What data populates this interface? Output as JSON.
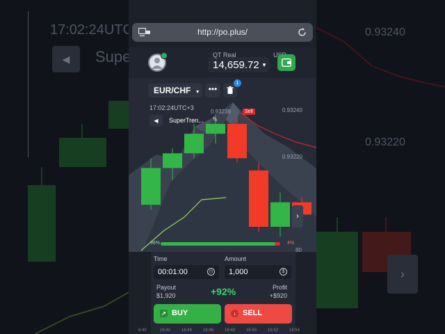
{
  "browser": {
    "url": "http://po.plus/"
  },
  "account": {
    "type": "QT Real",
    "currency": "USD",
    "balance": "14,659.72"
  },
  "chart": {
    "pair": "EUR/CHF",
    "menu_dots": "•••",
    "trash_count": "1",
    "clock": "17:02:24UTC+3",
    "indicator": "SuperTren...",
    "sell_tag": "Sell",
    "prices": [
      "0.93240",
      "0.93238",
      "0.93220"
    ],
    "partial_label": "80",
    "candles": [
      {
        "open": 0.93205,
        "close": 0.9322,
        "high": 0.93224,
        "low": 0.93203,
        "dir": "up"
      },
      {
        "open": 0.9322,
        "close": 0.93226,
        "high": 0.93228,
        "low": 0.93215,
        "dir": "up"
      },
      {
        "open": 0.93226,
        "close": 0.93234,
        "high": 0.93238,
        "low": 0.93224,
        "dir": "up"
      },
      {
        "open": 0.93234,
        "close": 0.93238,
        "high": 0.93242,
        "low": 0.9323,
        "dir": "up"
      },
      {
        "open": 0.93238,
        "close": 0.93224,
        "high": 0.9324,
        "low": 0.93222,
        "dir": "down"
      },
      {
        "open": 0.93219,
        "close": 0.93196,
        "high": 0.93222,
        "low": 0.93194,
        "dir": "down"
      },
      {
        "open": 0.93196,
        "close": 0.93206,
        "high": 0.9321,
        "low": 0.93192,
        "dir": "up"
      },
      {
        "open": 0.93206,
        "close": 0.93201,
        "high": 0.93208,
        "low": 0.93198,
        "dir": "down"
      }
    ]
  },
  "sentiment": {
    "buy_pct": 96,
    "buy_label": "96%",
    "sell_label": "4%"
  },
  "trade": {
    "time_label": "Time",
    "time_value": "00:01:00",
    "amount_label": "Amount",
    "amount_value": "1,000",
    "payout_label": "Payout",
    "payout_amount": "$1,920",
    "payout_pct": "+92%",
    "profit_label": "Profit",
    "profit_amount": "+$920",
    "buy_label": "BUY",
    "sell_label": "SELL"
  },
  "xaxis": [
    "6:40",
    "16:42",
    "16:44",
    "16:46",
    "16:48",
    "16:50",
    "16:52",
    "16:54"
  ],
  "backdrop": {
    "left_clock": "17:02:24UTC",
    "left_indicator": "Super",
    "right_prices": [
      "0.93240",
      "0.93220"
    ]
  },
  "colors": {
    "up": "#34b547",
    "down": "#f23b27",
    "supertrend_up": "#9bd35a",
    "supertrend_down": "#c8262c"
  }
}
